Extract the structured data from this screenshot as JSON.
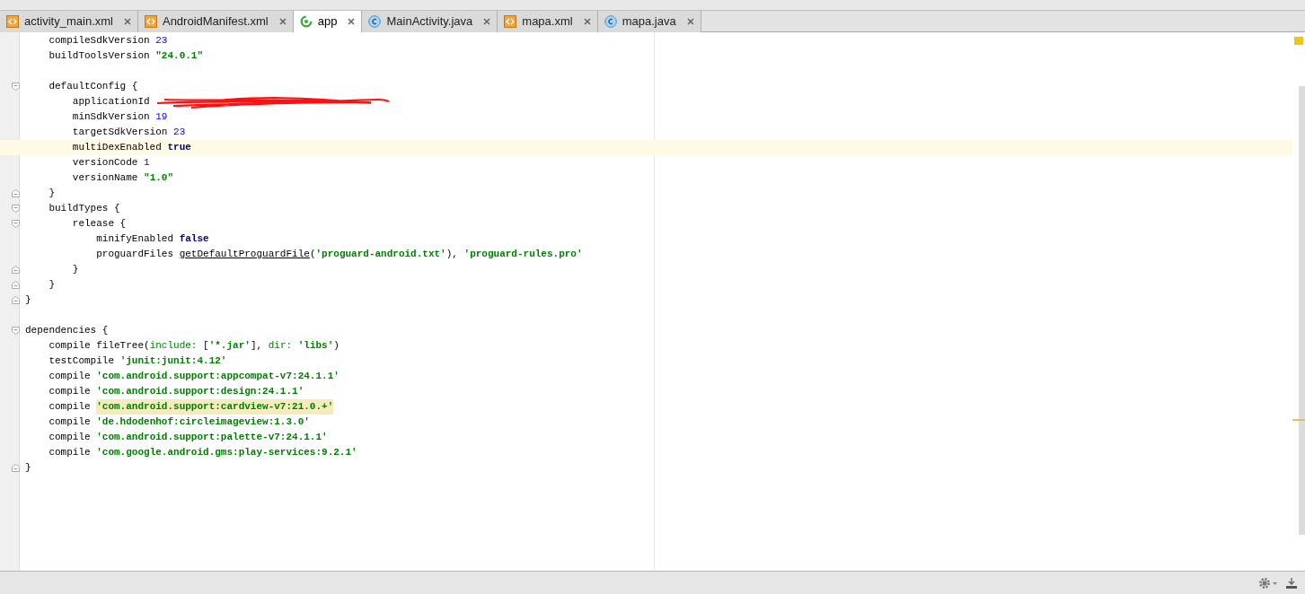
{
  "tabs": [
    {
      "label": "activity_main.xml",
      "kind": "xml",
      "selected": false
    },
    {
      "label": "AndroidManifest.xml",
      "kind": "xml",
      "selected": false
    },
    {
      "label": "app",
      "kind": "gradle",
      "selected": true
    },
    {
      "label": "MainActivity.java",
      "kind": "java",
      "selected": false
    },
    {
      "label": "mapa.xml",
      "kind": "xml",
      "selected": false
    },
    {
      "label": "mapa.java",
      "kind": "java",
      "selected": false
    }
  ],
  "editor": {
    "lines": [
      {
        "kind": "line",
        "current": false,
        "tokens": [
          {
            "kind": "plain",
            "text": "    compileSdkVersion "
          },
          {
            "kind": "num",
            "text": "23"
          }
        ]
      },
      {
        "kind": "line",
        "current": false,
        "tokens": [
          {
            "kind": "plain",
            "text": "    buildToolsVersion "
          },
          {
            "kind": "str",
            "text": "\"24.0.1\""
          }
        ]
      },
      {
        "kind": "line",
        "current": false
      },
      {
        "kind": "fold_start",
        "current": false,
        "tokens": [
          {
            "kind": "plain",
            "text": "    defaultConfig {"
          }
        ]
      },
      {
        "kind": "line",
        "current": false,
        "tokens": [
          {
            "kind": "plain",
            "text": "        applicationId "
          },
          {
            "kind": "redacted"
          }
        ]
      },
      {
        "kind": "line",
        "current": false,
        "tokens": [
          {
            "kind": "plain",
            "text": "        minSdkVersion "
          },
          {
            "kind": "num",
            "text": "19"
          }
        ]
      },
      {
        "kind": "line",
        "current": false,
        "tokens": [
          {
            "kind": "plain",
            "text": "        targetSdkVersion "
          },
          {
            "kind": "num",
            "text": "23"
          }
        ]
      },
      {
        "kind": "line",
        "current": true,
        "tokens": [
          {
            "kind": "plain",
            "text": "        multiDexEnabled "
          },
          {
            "kind": "kw",
            "text": "true"
          }
        ]
      },
      {
        "kind": "line",
        "current": false,
        "tokens": [
          {
            "kind": "plain",
            "text": "        versionCode "
          },
          {
            "kind": "num",
            "text": "1"
          }
        ]
      },
      {
        "kind": "line",
        "current": false,
        "tokens": [
          {
            "kind": "plain",
            "text": "        versionName "
          },
          {
            "kind": "str",
            "text": "\"1.0\""
          }
        ]
      },
      {
        "kind": "fold_end",
        "current": false,
        "tokens": [
          {
            "kind": "plain",
            "text": "    }"
          }
        ]
      },
      {
        "kind": "fold_start",
        "current": false,
        "tokens": [
          {
            "kind": "plain",
            "text": "    buildTypes {"
          }
        ]
      },
      {
        "kind": "fold_start",
        "current": false,
        "tokens": [
          {
            "kind": "plain",
            "text": "        release {"
          }
        ]
      },
      {
        "kind": "line",
        "current": false,
        "tokens": [
          {
            "kind": "plain",
            "text": "            minifyEnabled "
          },
          {
            "kind": "kw",
            "text": "false"
          }
        ]
      },
      {
        "kind": "line",
        "current": false,
        "tokens": [
          {
            "kind": "plain",
            "text": "            proguardFiles "
          },
          {
            "kind": "fn",
            "text": "getDefaultProguardFile"
          },
          {
            "kind": "plain",
            "text": "("
          },
          {
            "kind": "str",
            "text": "'proguard-android.txt'"
          },
          {
            "kind": "plain",
            "text": "), "
          },
          {
            "kind": "str",
            "text": "'proguard-rules.pro'"
          }
        ]
      },
      {
        "kind": "fold_end",
        "current": false,
        "tokens": [
          {
            "kind": "plain",
            "text": "        }"
          }
        ]
      },
      {
        "kind": "fold_end",
        "current": false,
        "tokens": [
          {
            "kind": "plain",
            "text": "    }"
          }
        ]
      },
      {
        "kind": "fold_end",
        "current": false,
        "tokens": [
          {
            "kind": "plain",
            "text": "}"
          }
        ]
      },
      {
        "kind": "line",
        "current": false
      },
      {
        "kind": "fold_start",
        "current": false,
        "tokens": [
          {
            "kind": "plain",
            "text": "dependencies {"
          }
        ]
      },
      {
        "kind": "line",
        "current": false,
        "tokens": [
          {
            "kind": "plain",
            "text": "    compile fileTree("
          },
          {
            "kind": "arg",
            "text": "include: "
          },
          {
            "kind": "plain",
            "text": "["
          },
          {
            "kind": "str",
            "text": "'*.jar'"
          },
          {
            "kind": "plain",
            "text": "], "
          },
          {
            "kind": "arg",
            "text": "dir: "
          },
          {
            "kind": "str",
            "text": "'libs'"
          },
          {
            "kind": "plain",
            "text": ")"
          }
        ]
      },
      {
        "kind": "line",
        "current": false,
        "tokens": [
          {
            "kind": "plain",
            "text": "    testCompile "
          },
          {
            "kind": "str",
            "text": "'junit:junit:4.12'"
          }
        ]
      },
      {
        "kind": "line",
        "current": false,
        "tokens": [
          {
            "kind": "plain",
            "text": "    compile "
          },
          {
            "kind": "str",
            "text": "'com.android.support:appcompat-v7:24.1.1'"
          }
        ]
      },
      {
        "kind": "line",
        "current": false,
        "tokens": [
          {
            "kind": "plain",
            "text": "    compile "
          },
          {
            "kind": "str",
            "text": "'com.android.support:design:24.1.1'"
          }
        ]
      },
      {
        "kind": "line",
        "current": false,
        "tokens": [
          {
            "kind": "plain",
            "text": "    compile "
          },
          {
            "kind": "str",
            "text": "'com.android.support:cardview-v7:21.0.+'",
            "highlighted": true
          }
        ]
      },
      {
        "kind": "line",
        "current": false,
        "tokens": [
          {
            "kind": "plain",
            "text": "    compile "
          },
          {
            "kind": "str",
            "text": "'de.hdodenhof:circleimageview:1.3.0'"
          }
        ]
      },
      {
        "kind": "line",
        "current": false,
        "tokens": [
          {
            "kind": "plain",
            "text": "    compile "
          },
          {
            "kind": "str",
            "text": "'com.android.support:palette-v7:24.1.1'"
          }
        ]
      },
      {
        "kind": "line",
        "current": false,
        "tokens": [
          {
            "kind": "plain",
            "text": "    compile "
          },
          {
            "kind": "str",
            "text": "'com.google.android.gms:play-services:9.2.1'"
          }
        ]
      },
      {
        "kind": "fold_end",
        "current": false,
        "tokens": [
          {
            "kind": "plain",
            "text": "}"
          }
        ]
      }
    ]
  }
}
